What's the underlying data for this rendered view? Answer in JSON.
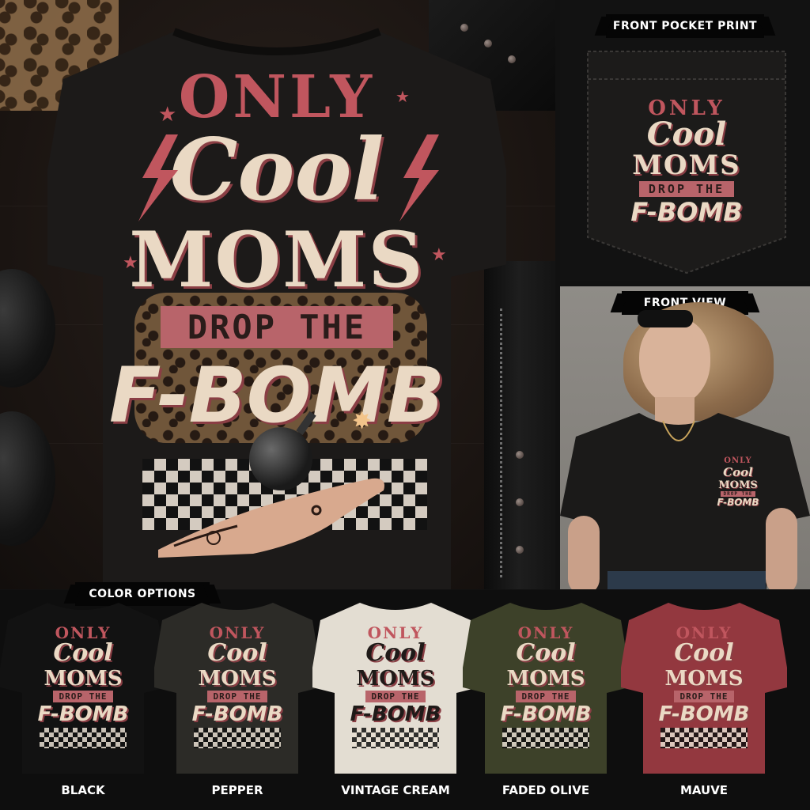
{
  "main": {
    "design": {
      "line1": "ONLY",
      "line2": "Cool",
      "line3": "MOMS",
      "line4": "DROP THE",
      "line5": "F-BOMB"
    }
  },
  "pocket": {
    "banner": "FRONT POCKET PRINT",
    "design": {
      "line1": "ONLY",
      "line2": "Cool",
      "line3": "MOMS",
      "line4": "DROP THE",
      "line5": "F-BOMB"
    }
  },
  "front": {
    "banner": "FRONT VIEW",
    "design": {
      "line1": "ONLY",
      "line2": "Cool",
      "line3": "MOMS",
      "line4": "DROP THE",
      "line5": "F-BOMB"
    }
  },
  "color_options": {
    "banner": "COLOR OPTIONS",
    "swatches": [
      {
        "label": "BLACK",
        "color": "#121212",
        "text": {
          "line1": "ONLY",
          "line2": "Cool",
          "line3": "MOMS",
          "line4": "DROP THE",
          "line5": "F-BOMB"
        }
      },
      {
        "label": "PEPPER",
        "color": "#2c2b27",
        "text": {
          "line1": "ONLY",
          "line2": "Cool",
          "line3": "MOMS",
          "line4": "DROP THE",
          "line5": "F-BOMB"
        }
      },
      {
        "label": "VINTAGE CREAM",
        "color": "#e3ddd2",
        "text": {
          "line1": "ONLY",
          "line2": "Cool",
          "line3": "MOMS",
          "line4": "DROP THE",
          "line5": "F-BOMB"
        }
      },
      {
        "label": "FADED OLIVE",
        "color": "#3d4129",
        "text": {
          "line1": "ONLY",
          "line2": "Cool",
          "line3": "MOMS",
          "line4": "DROP THE",
          "line5": "F-BOMB"
        }
      },
      {
        "label": "MAUVE",
        "color": "#93383f",
        "text": {
          "line1": "ONLY",
          "line2": "Cool",
          "line3": "MOMS",
          "line4": "DROP THE",
          "line5": "F-BOMB"
        }
      }
    ]
  },
  "colors": {
    "accent_pink": "#c0565e",
    "cream": "#ead9c4",
    "banner_bg": "#050505"
  }
}
